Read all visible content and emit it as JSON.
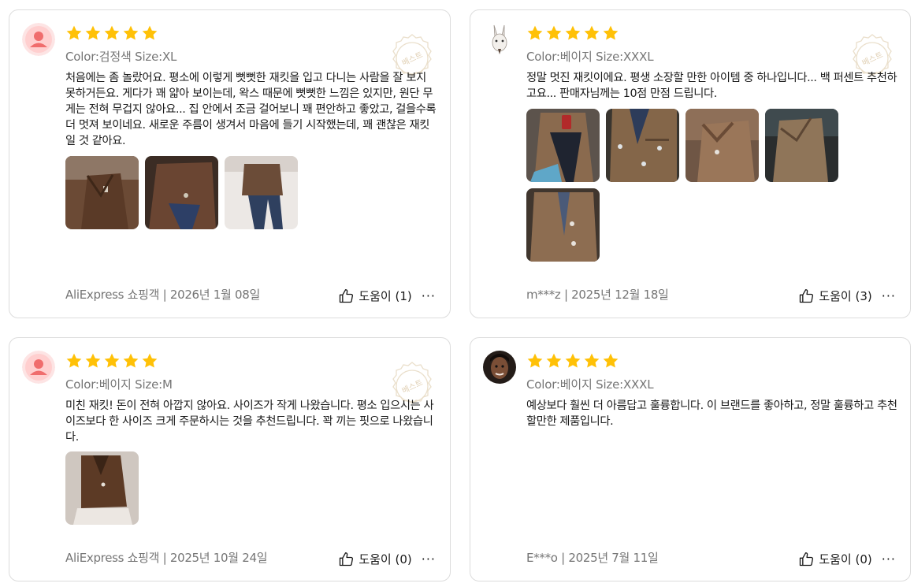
{
  "colors": {
    "star": "#FFC107",
    "border": "#dcdcdc",
    "meta_text": "#757575",
    "seal": "#e7d7bb"
  },
  "reviews": [
    {
      "rating": 5,
      "avatar_icon": "default-user-avatar-icon",
      "meta": "Color:검정색 Size:XL",
      "badge": "베스트",
      "text": "처음에는 좀 놀랐어요. 평소에 이렇게 뻣뻣한 재킷을 입고 다니는 사람을 잘 보지 못하거든요. 게다가 꽤 얇아 보이는데, 왁스 때문에 뻣뻣한 느낌은 있지만, 원단 무게는 전혀 무겁지 않아요... 집 안에서 조금 걸어보니 꽤 편안하고 좋았고, 걸을수록 더 멋져 보이네요. 새로운 주름이 생겨서 마음에 들기 시작했는데, 꽤 괜찮은 재킷일 것 같아요.",
      "photo_count": 3,
      "footer": "AliExpress 쇼핑객 | 2026년 1월 08일",
      "helpful": "도움이 (1)",
      "more": "···"
    },
    {
      "rating": 5,
      "avatar_icon": "rabbit-mask-avatar-icon",
      "meta": "Color:베이지 Size:XXXL",
      "badge": "베스트",
      "text": "정말 멋진 재킷이에요. 평생 소장할 만한 아이템 중 하나입니다... 백 퍼센트 추천하고요... 판매자님께는 10점 만점 드립니다.",
      "photo_count": 5,
      "footer": "m***z | 2025년 12월 18일",
      "helpful": "도움이 (3)",
      "more": "···"
    },
    {
      "rating": 5,
      "avatar_icon": "default-user-avatar-icon",
      "meta": "Color:베이지 Size:M",
      "badge": "베스트",
      "text": "미친 재킷! 돈이 전혀 아깝지 않아요. 사이즈가 작게 나왔습니다. 평소 입으시는 사이즈보다 한 사이즈 크게 주문하시는 것을 추천드립니다. 꽉 끼는 핏으로 나왔습니다.",
      "photo_count": 1,
      "footer": "AliExpress 쇼핑객 | 2025년 10월 24일",
      "helpful": "도움이 (0)",
      "more": "···"
    },
    {
      "rating": 5,
      "avatar_icon": "photo-avatar-icon",
      "meta": "Color:베이지 Size:XXXL",
      "text": "예상보다 훨씬 더 아름답고 훌륭합니다. 이 브랜드를 좋아하고, 정말 훌륭하고 추천할만한 제품입니다.",
      "photo_count": 0,
      "footer": "E***o | 2025년 7월 11일",
      "helpful": "도움이 (0)",
      "more": "···"
    }
  ]
}
